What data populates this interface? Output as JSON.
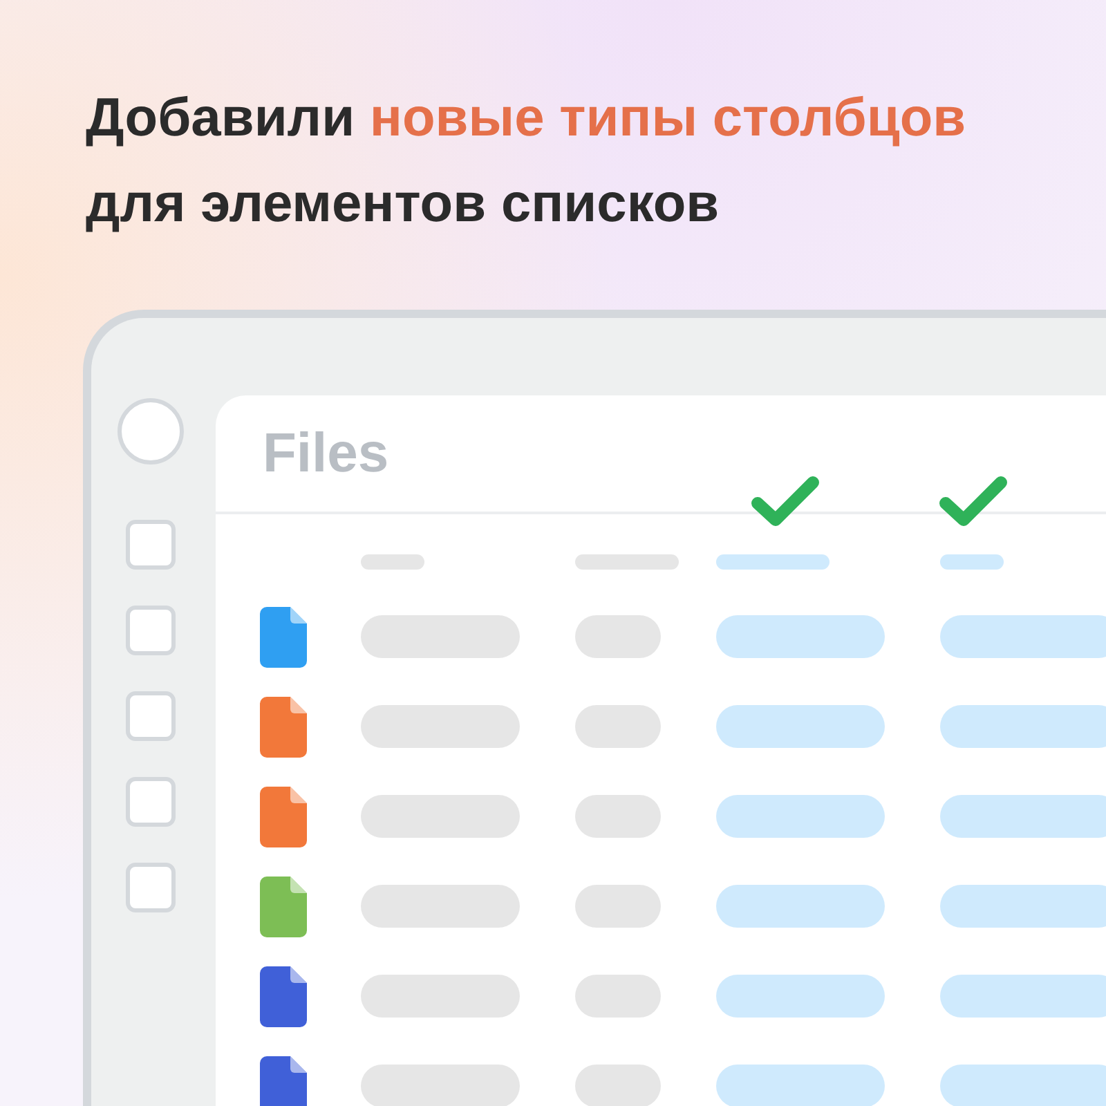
{
  "headline": [
    {
      "text": "Добавили ",
      "kind": "plain"
    },
    {
      "text": "новые типы столбцов",
      "kind": "accent"
    },
    {
      "text": " для элементов списков",
      "kind": "plain"
    }
  ],
  "window": {
    "title": "Files"
  },
  "sidebar": {
    "checkboxes": [
      {
        "checked": false
      },
      {
        "checked": false
      },
      {
        "checked": false
      },
      {
        "checked": false
      },
      {
        "checked": false
      }
    ]
  },
  "table": {
    "columns": [
      {
        "highlighted": false
      },
      {
        "highlighted": false
      },
      {
        "highlighted": true
      },
      {
        "highlighted": true
      }
    ],
    "rows": [
      {
        "color": "#2f9ff2"
      },
      {
        "color": "#f2783a"
      },
      {
        "color": "#f2783a"
      },
      {
        "color": "#7dbe55"
      },
      {
        "color": "#4060d8"
      },
      {
        "color": "#4060d8"
      }
    ]
  }
}
